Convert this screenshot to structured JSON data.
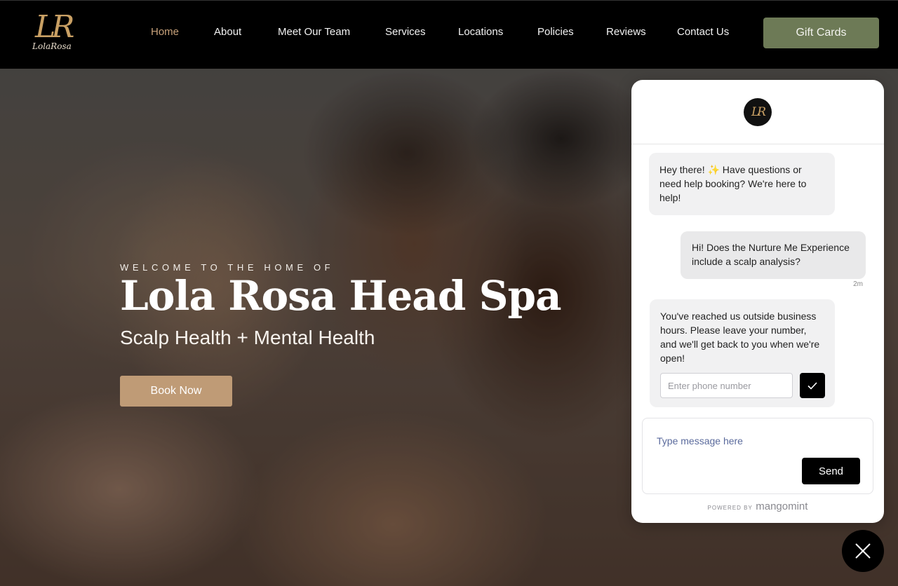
{
  "nav": {
    "logo": {
      "mark": "LR",
      "script": "LolaRosa"
    },
    "links": [
      {
        "label": "Home",
        "active": true
      },
      {
        "label": "About"
      },
      {
        "label": "Meet Our Team"
      },
      {
        "label": "Services"
      },
      {
        "label": "Locations"
      },
      {
        "label": "Policies"
      },
      {
        "label": "Reviews"
      },
      {
        "label": "Contact Us"
      }
    ],
    "gift_cards": "Gift Cards",
    "colors": {
      "background": "#000000",
      "active_link": "#c8a27a",
      "gift_button": "#6d7a56"
    }
  },
  "hero": {
    "welcome": "WELCOME TO THE HOME OF",
    "title": "Lola Rosa Head Spa",
    "subtitle": "Scalp Health + Mental Health",
    "book_now": "Book Now",
    "book_color": "#bf9b76"
  },
  "chat": {
    "avatar_mark": "LR",
    "messages": [
      {
        "from": "business",
        "text": "Hey there! ✨ Have questions or need help booking? We're here to help!"
      },
      {
        "from": "user",
        "text": "Hi! Does the Nurture Me Experience include a scalp analysis?",
        "time": "2m"
      },
      {
        "from": "business",
        "text": "You've reached us outside business hours. Please leave your number, and we'll get back to you when we're open!"
      }
    ],
    "phone_placeholder": "Enter phone number",
    "compose_placeholder": "Type message here",
    "send": "Send",
    "powered_by": "POWERED BY",
    "powered_brand": "mangomint",
    "icons": {
      "phone_submit": "check-icon",
      "close": "close-icon"
    }
  }
}
